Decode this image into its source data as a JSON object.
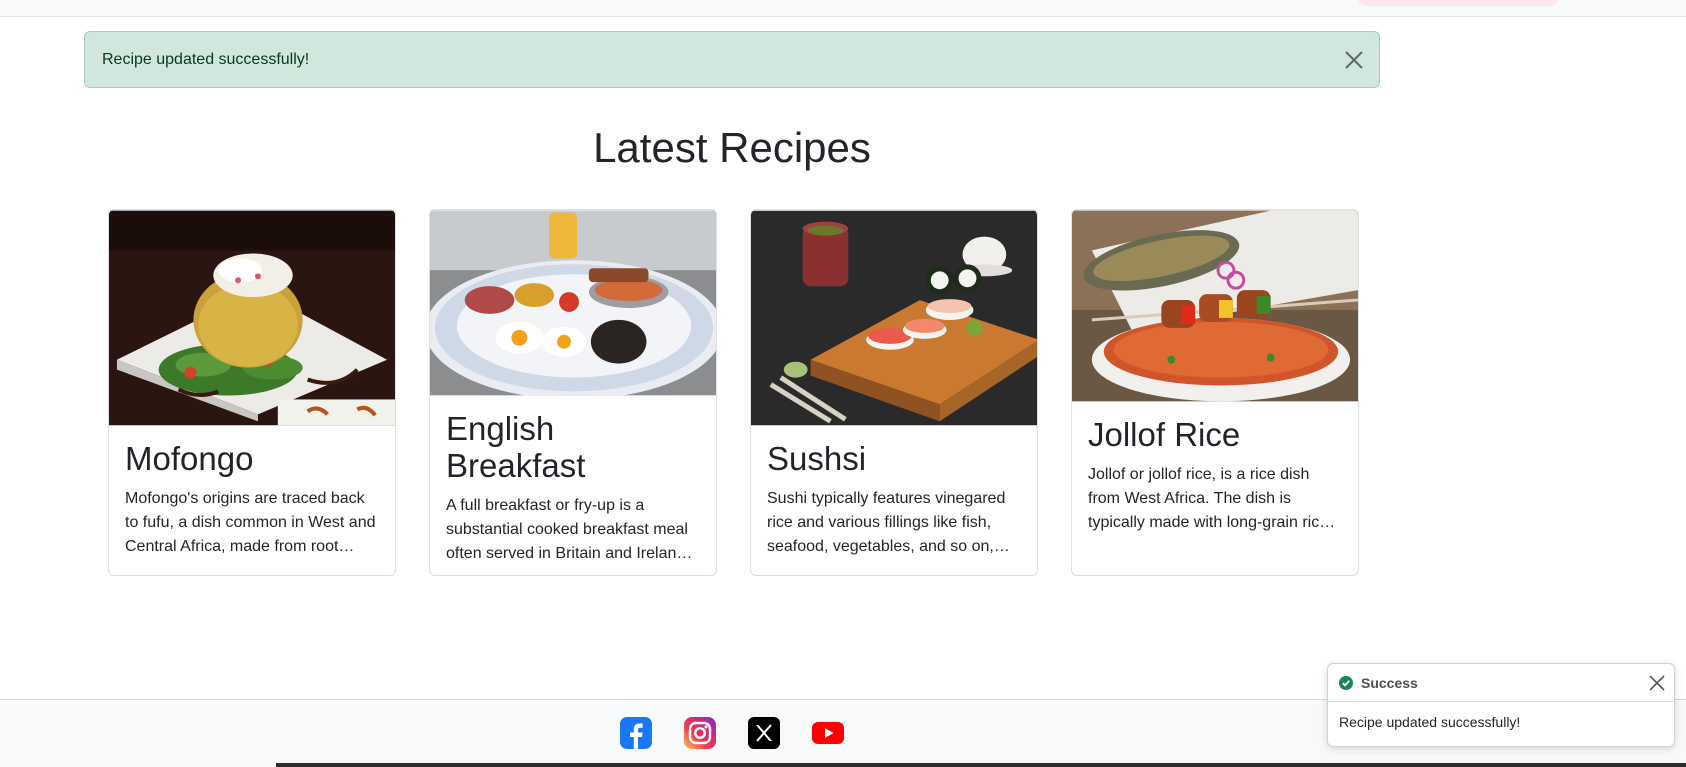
{
  "alert": {
    "message": "Recipe updated successfully!"
  },
  "section": {
    "title": "Latest Recipes"
  },
  "recipes": [
    {
      "title": "Mofongo",
      "description": "Mofongo's origins are traced back to fufu, a dish common in West and Central Africa, made from root vegetables and plantains."
    },
    {
      "title": "English Breakfast",
      "description": "A full breakfast or fry-up is a substantial cooked breakfast meal often served in Britain and Ireland, typically including bacon and eggs."
    },
    {
      "title": "Sushsi",
      "description": "Sushi typically features vinegared rice and various fillings like fish, seafood, vegetables, and so on, served in many forms."
    },
    {
      "title": "Jollof Rice",
      "description": "Jollof or jollof rice, is a rice dish from West Africa. The dish is typically made with long-grain rice, tomatoes, onions and spices."
    }
  ],
  "footer": {
    "social": [
      "facebook-icon",
      "instagram-icon",
      "x-icon",
      "youtube-icon"
    ]
  },
  "toast": {
    "title": "Success",
    "message": "Recipe updated successfully!"
  },
  "colors": {
    "alert_bg": "#d1e7dd",
    "alert_text": "#0a3622",
    "success_green": "#198754",
    "facebook_blue": "#1877f2",
    "youtube_red": "#ff0000"
  }
}
